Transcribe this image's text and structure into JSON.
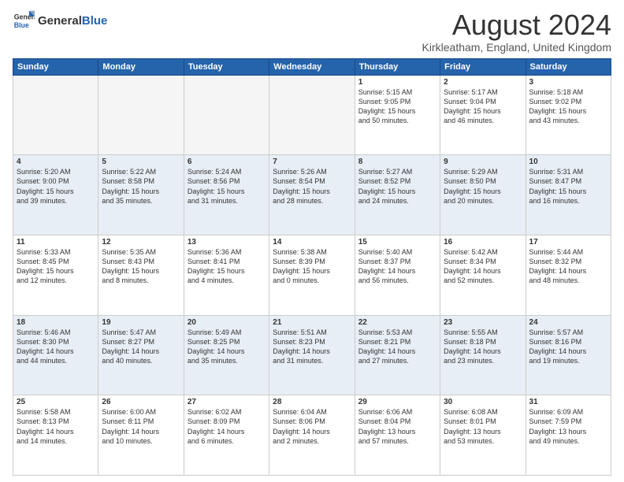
{
  "header": {
    "logo_general": "General",
    "logo_blue": "Blue",
    "month_title": "August 2024",
    "location": "Kirkleatham, England, United Kingdom"
  },
  "columns": [
    "Sunday",
    "Monday",
    "Tuesday",
    "Wednesday",
    "Thursday",
    "Friday",
    "Saturday"
  ],
  "weeks": [
    [
      {
        "day": "",
        "info": ""
      },
      {
        "day": "",
        "info": ""
      },
      {
        "day": "",
        "info": ""
      },
      {
        "day": "",
        "info": ""
      },
      {
        "day": "1",
        "info": "Sunrise: 5:15 AM\nSunset: 9:05 PM\nDaylight: 15 hours\nand 50 minutes."
      },
      {
        "day": "2",
        "info": "Sunrise: 5:17 AM\nSunset: 9:04 PM\nDaylight: 15 hours\nand 46 minutes."
      },
      {
        "day": "3",
        "info": "Sunrise: 5:18 AM\nSunset: 9:02 PM\nDaylight: 15 hours\nand 43 minutes."
      }
    ],
    [
      {
        "day": "4",
        "info": "Sunrise: 5:20 AM\nSunset: 9:00 PM\nDaylight: 15 hours\nand 39 minutes."
      },
      {
        "day": "5",
        "info": "Sunrise: 5:22 AM\nSunset: 8:58 PM\nDaylight: 15 hours\nand 35 minutes."
      },
      {
        "day": "6",
        "info": "Sunrise: 5:24 AM\nSunset: 8:56 PM\nDaylight: 15 hours\nand 31 minutes."
      },
      {
        "day": "7",
        "info": "Sunrise: 5:26 AM\nSunset: 8:54 PM\nDaylight: 15 hours\nand 28 minutes."
      },
      {
        "day": "8",
        "info": "Sunrise: 5:27 AM\nSunset: 8:52 PM\nDaylight: 15 hours\nand 24 minutes."
      },
      {
        "day": "9",
        "info": "Sunrise: 5:29 AM\nSunset: 8:50 PM\nDaylight: 15 hours\nand 20 minutes."
      },
      {
        "day": "10",
        "info": "Sunrise: 5:31 AM\nSunset: 8:47 PM\nDaylight: 15 hours\nand 16 minutes."
      }
    ],
    [
      {
        "day": "11",
        "info": "Sunrise: 5:33 AM\nSunset: 8:45 PM\nDaylight: 15 hours\nand 12 minutes."
      },
      {
        "day": "12",
        "info": "Sunrise: 5:35 AM\nSunset: 8:43 PM\nDaylight: 15 hours\nand 8 minutes."
      },
      {
        "day": "13",
        "info": "Sunrise: 5:36 AM\nSunset: 8:41 PM\nDaylight: 15 hours\nand 4 minutes."
      },
      {
        "day": "14",
        "info": "Sunrise: 5:38 AM\nSunset: 8:39 PM\nDaylight: 15 hours\nand 0 minutes."
      },
      {
        "day": "15",
        "info": "Sunrise: 5:40 AM\nSunset: 8:37 PM\nDaylight: 14 hours\nand 56 minutes."
      },
      {
        "day": "16",
        "info": "Sunrise: 5:42 AM\nSunset: 8:34 PM\nDaylight: 14 hours\nand 52 minutes."
      },
      {
        "day": "17",
        "info": "Sunrise: 5:44 AM\nSunset: 8:32 PM\nDaylight: 14 hours\nand 48 minutes."
      }
    ],
    [
      {
        "day": "18",
        "info": "Sunrise: 5:46 AM\nSunset: 8:30 PM\nDaylight: 14 hours\nand 44 minutes."
      },
      {
        "day": "19",
        "info": "Sunrise: 5:47 AM\nSunset: 8:27 PM\nDaylight: 14 hours\nand 40 minutes."
      },
      {
        "day": "20",
        "info": "Sunrise: 5:49 AM\nSunset: 8:25 PM\nDaylight: 14 hours\nand 35 minutes."
      },
      {
        "day": "21",
        "info": "Sunrise: 5:51 AM\nSunset: 8:23 PM\nDaylight: 14 hours\nand 31 minutes."
      },
      {
        "day": "22",
        "info": "Sunrise: 5:53 AM\nSunset: 8:21 PM\nDaylight: 14 hours\nand 27 minutes."
      },
      {
        "day": "23",
        "info": "Sunrise: 5:55 AM\nSunset: 8:18 PM\nDaylight: 14 hours\nand 23 minutes."
      },
      {
        "day": "24",
        "info": "Sunrise: 5:57 AM\nSunset: 8:16 PM\nDaylight: 14 hours\nand 19 minutes."
      }
    ],
    [
      {
        "day": "25",
        "info": "Sunrise: 5:58 AM\nSunset: 8:13 PM\nDaylight: 14 hours\nand 14 minutes."
      },
      {
        "day": "26",
        "info": "Sunrise: 6:00 AM\nSunset: 8:11 PM\nDaylight: 14 hours\nand 10 minutes."
      },
      {
        "day": "27",
        "info": "Sunrise: 6:02 AM\nSunset: 8:09 PM\nDaylight: 14 hours\nand 6 minutes."
      },
      {
        "day": "28",
        "info": "Sunrise: 6:04 AM\nSunset: 8:06 PM\nDaylight: 14 hours\nand 2 minutes."
      },
      {
        "day": "29",
        "info": "Sunrise: 6:06 AM\nSunset: 8:04 PM\nDaylight: 13 hours\nand 57 minutes."
      },
      {
        "day": "30",
        "info": "Sunrise: 6:08 AM\nSunset: 8:01 PM\nDaylight: 13 hours\nand 53 minutes."
      },
      {
        "day": "31",
        "info": "Sunrise: 6:09 AM\nSunset: 7:59 PM\nDaylight: 13 hours\nand 49 minutes."
      }
    ]
  ]
}
